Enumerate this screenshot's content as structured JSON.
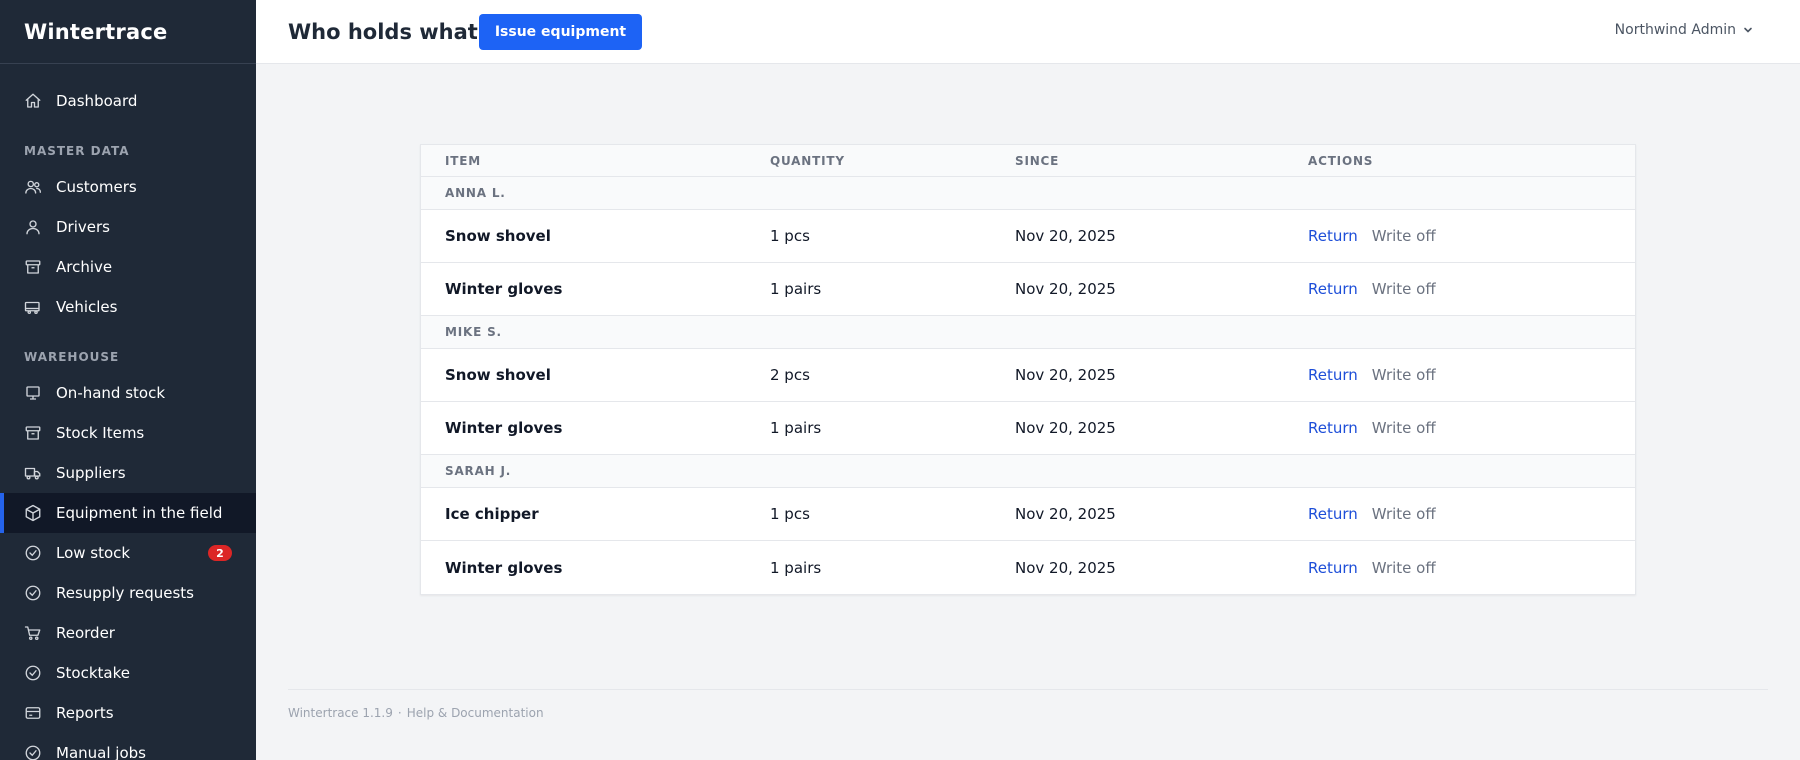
{
  "app": {
    "name": "Wintertrace"
  },
  "header": {
    "title": "Who holds what",
    "primary_button": "Issue equipment",
    "user_menu": "Northwind Admin"
  },
  "sidebar": {
    "dashboard": "Dashboard",
    "section_master": "MASTER DATA",
    "customers": "Customers",
    "drivers": "Drivers",
    "archive": "Archive",
    "vehicles": "Vehicles",
    "section_warehouse": "WAREHOUSE",
    "on_hand": "On-hand stock",
    "stock_items": "Stock Items",
    "suppliers": "Suppliers",
    "equipment_field": "Equipment in the field",
    "low_stock": "Low stock",
    "low_stock_badge": "2",
    "resupply": "Resupply requests",
    "reorder": "Reorder",
    "stocktake": "Stocktake",
    "reports": "Reports",
    "manual_jobs": "Manual jobs",
    "active_item": "Equipment in the field"
  },
  "table": {
    "columns": [
      "ITEM",
      "QUANTITY",
      "SINCE",
      "ACTIONS"
    ],
    "return_label": "Return",
    "writeoff_label": "Write off",
    "groups": [
      {
        "holder": "ANNA L.",
        "rows": [
          {
            "item": "Snow shovel",
            "quantity": "1 pcs",
            "since": "Nov 20, 2025"
          },
          {
            "item": "Winter gloves",
            "quantity": "1 pairs",
            "since": "Nov 20, 2025"
          }
        ]
      },
      {
        "holder": "MIKE S.",
        "rows": [
          {
            "item": "Snow shovel",
            "quantity": "2 pcs",
            "since": "Nov 20, 2025"
          },
          {
            "item": "Winter gloves",
            "quantity": "1 pairs",
            "since": "Nov 20, 2025"
          }
        ]
      },
      {
        "holder": "SARAH J.",
        "rows": [
          {
            "item": "Ice chipper",
            "quantity": "1 pcs",
            "since": "Nov 20, 2025"
          },
          {
            "item": "Winter gloves",
            "quantity": "1 pairs",
            "since": "Nov 20, 2025"
          }
        ]
      }
    ]
  },
  "footer": {
    "version": "Wintertrace 1.1.9",
    "separator": "·",
    "help": "Help & Documentation"
  },
  "colors": {
    "sidebar_bg": "#1f2937",
    "accent": "#1d63f5",
    "link": "#1d4ed8",
    "badge": "#dc2626"
  }
}
